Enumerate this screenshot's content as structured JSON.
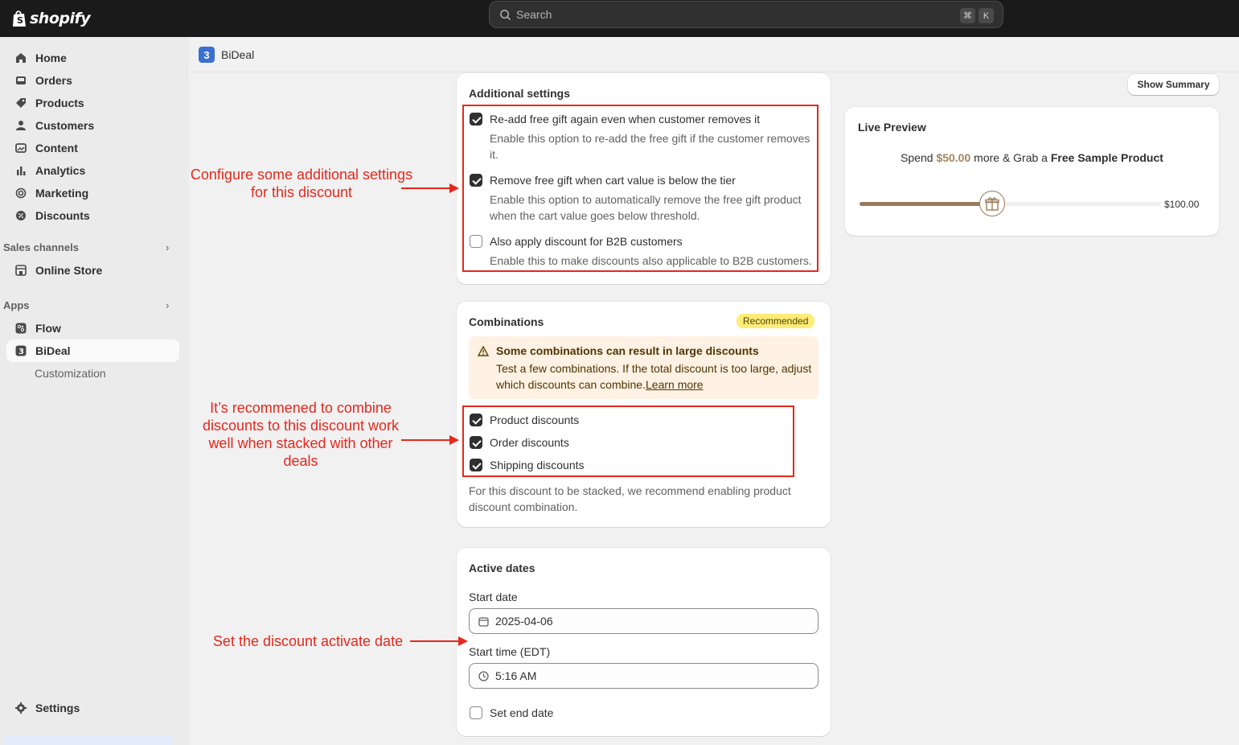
{
  "topbar": {
    "brand": "shopify",
    "search_placeholder": "Search",
    "shortcut_keys": [
      "⌘",
      "K"
    ]
  },
  "sidebar": {
    "items": [
      {
        "label": "Home",
        "icon": "home-icon"
      },
      {
        "label": "Orders",
        "icon": "inbox-icon"
      },
      {
        "label": "Products",
        "icon": "tag-icon"
      },
      {
        "label": "Customers",
        "icon": "person-icon"
      },
      {
        "label": "Content",
        "icon": "image-icon"
      },
      {
        "label": "Analytics",
        "icon": "bar-chart-icon"
      },
      {
        "label": "Marketing",
        "icon": "target-icon"
      },
      {
        "label": "Discounts",
        "icon": "discount-icon"
      }
    ],
    "sales_channels_label": "Sales channels",
    "online_store": "Online Store",
    "apps_label": "Apps",
    "flow": "Flow",
    "bideal": "BiDeal",
    "customization": "Customization",
    "settings": "Settings"
  },
  "header": {
    "app_logo_letter": "3",
    "app_name": "BiDeal"
  },
  "additional_settings": {
    "title": "Additional settings",
    "options": [
      {
        "label": "Re-add free gift again even when customer removes it",
        "help": "Enable this option to re-add the free gift if the customer removes it.",
        "checked": true
      },
      {
        "label": "Remove free gift when cart value is below the tier",
        "help": "Enable this option to automatically remove the free gift product when the cart value goes below threshold.",
        "checked": true
      },
      {
        "label": "Also apply discount for B2B customers",
        "help": "Enable this to make discounts also applicable to B2B customers.",
        "checked": false
      }
    ]
  },
  "combinations": {
    "title": "Combinations",
    "badge": "Recommended",
    "warning_title": "Some combinations can result in large discounts",
    "warning_text": "Test a few combinations. If the total discount is too large, adjust which discounts can combine.",
    "learn_more": "Learn more",
    "options": [
      {
        "label": "Product discounts",
        "checked": true
      },
      {
        "label": "Order discounts",
        "checked": true
      },
      {
        "label": "Shipping discounts",
        "checked": true
      }
    ],
    "note": "For this discount to be stacked, we recommend enabling product discount combination."
  },
  "active_dates": {
    "title": "Active dates",
    "start_date_label": "Start date",
    "start_date_value": "2025-04-06",
    "start_time_label": "Start time (EDT)",
    "start_time_value": "5:16 AM",
    "set_end_date_label": "Set end date",
    "set_end_date_checked": false
  },
  "live_preview": {
    "show_summary": "Show Summary",
    "title": "Live Preview",
    "spend_prefix": "Spend",
    "spend_amount": "$50.00",
    "spend_middle": "more & Grab a",
    "product": "Free Sample Product",
    "progress": 0.5,
    "target_amount": "$100.00"
  },
  "annotations": {
    "settings_note": "Configure some additional settings for this discount",
    "combine_note": "It’s recommened to combine discounts to this discount work well when stacked with other deals",
    "date_note": "Set the discount activate date"
  },
  "colors": {
    "annotation_red": "#e5281d",
    "progress_brown": "#9b7a5c",
    "amount_brown": "#a4845c",
    "badge_yellow": "#ffeb78"
  }
}
